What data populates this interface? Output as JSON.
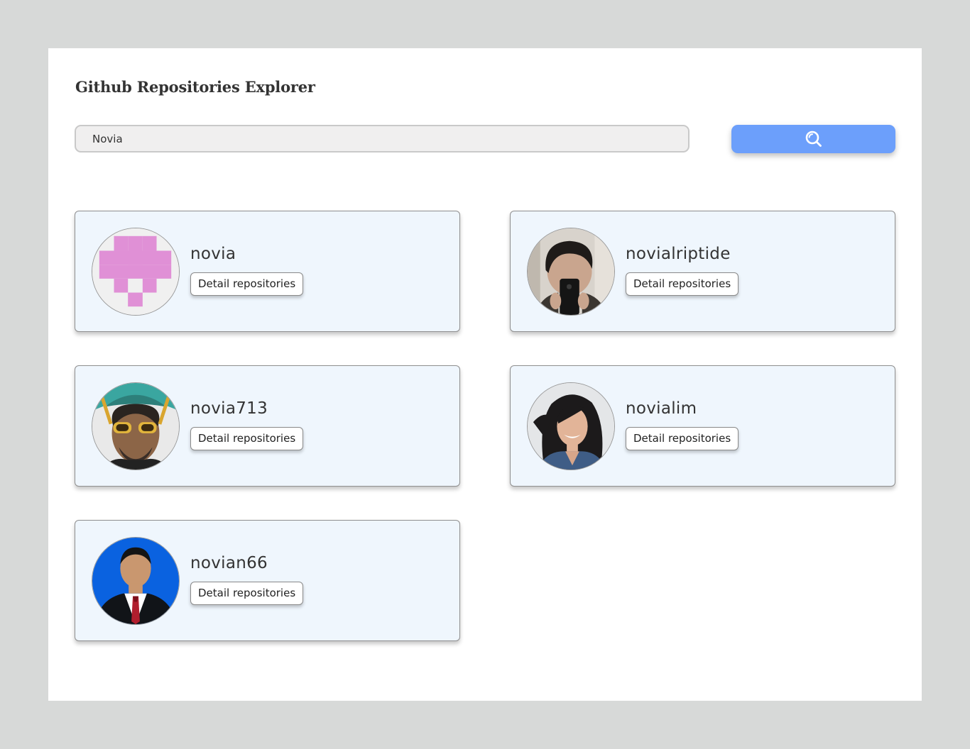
{
  "header": {
    "title": "Github Repositories Explorer"
  },
  "search": {
    "value": "Novia",
    "placeholder": "",
    "button_icon": "search-icon"
  },
  "results": [
    {
      "username": "novia",
      "button_label": "Detail repositories",
      "avatar": "pixel-heart-avatar"
    },
    {
      "username": "novialriptide",
      "button_label": "Detail repositories",
      "avatar": "mirror-selfie-avatar"
    },
    {
      "username": "novia713",
      "button_label": "Detail repositories",
      "avatar": "guitar-glasses-avatar"
    },
    {
      "username": "novialim",
      "button_label": "Detail repositories",
      "avatar": "portrait-woman-avatar"
    },
    {
      "username": "novian66",
      "button_label": "Detail repositories",
      "avatar": "formal-portrait-avatar"
    }
  ],
  "colors": {
    "page_background": "#d7d9d8",
    "card_background": "#eff6fd",
    "search_button": "#6c9ffb",
    "identicon": "#e090d6"
  }
}
